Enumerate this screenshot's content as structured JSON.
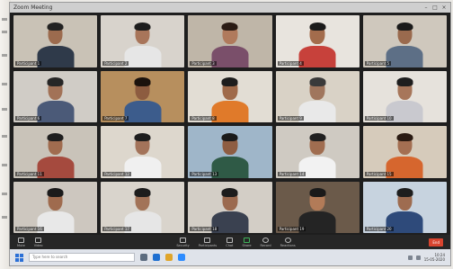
{
  "window": {
    "title": "Zoom Meeting"
  },
  "participants": [
    {
      "name": "Participant 1",
      "bg": "#c9c2b6",
      "skin": "#9c6b4e",
      "shirt": "#2f3a4a",
      "hair": "#222"
    },
    {
      "name": "Participant 2",
      "bg": "#d8d3cc",
      "skin": "#a8755a",
      "shirt": "#e6e6e6",
      "hair": "#1d1d1d"
    },
    {
      "name": "Participant 3",
      "bg": "#bfb6a8",
      "skin": "#b07a5c",
      "shirt": "#7a4f6a",
      "hair": "#2a1b14"
    },
    {
      "name": "Participant 4",
      "bg": "#e8e4de",
      "skin": "#a36c4c",
      "shirt": "#c7413b",
      "hair": "#1b1b1b"
    },
    {
      "name": "Participant 5",
      "bg": "#cfc8bd",
      "skin": "#9a6a4e",
      "shirt": "#5d6f86",
      "hair": "#1a1a1a"
    },
    {
      "name": "Participant 6",
      "bg": "#d0ccc6",
      "skin": "#a27257",
      "shirt": "#4b5a78",
      "hair": "#262626"
    },
    {
      "name": "Participant 7",
      "bg": "#b78f5e",
      "skin": "#8d5c40",
      "shirt": "#3c5c8c",
      "hair": "#1b120d"
    },
    {
      "name": "Participant 8",
      "bg": "#e2ddd4",
      "skin": "#9f6a4a",
      "shirt": "#e07a2a",
      "hair": "#1d1d1d"
    },
    {
      "name": "Participant 9",
      "bg": "#d9d2c6",
      "skin": "#a0765d",
      "shirt": "#e9e9e9",
      "hair": "#3a3a3a"
    },
    {
      "name": "Participant 10",
      "bg": "#e6e2dc",
      "skin": "#a7765a",
      "shirt": "#c9c9cf",
      "hair": "#1e1e1e"
    },
    {
      "name": "Participant 11",
      "bg": "#c9c3b9",
      "skin": "#a06c4f",
      "shirt": "#a54a3e",
      "hair": "#1e1e1e"
    },
    {
      "name": "Participant 12",
      "bg": "#ddd7cd",
      "skin": "#a3735a",
      "shirt": "#f0f0f0",
      "hair": "#1e1e1e"
    },
    {
      "name": "Participant 13",
      "bg": "#9fb6c9",
      "skin": "#8e5d42",
      "shirt": "#2f5a46",
      "hair": "#1a1a1a"
    },
    {
      "name": "Participant 14",
      "bg": "#cfcac2",
      "skin": "#a06d50",
      "shirt": "#f2f2f2",
      "hair": "#202020"
    },
    {
      "name": "Participant 15",
      "bg": "#d6cbbb",
      "skin": "#a46f52",
      "shirt": "#d6662e",
      "hair": "#2a1a12"
    },
    {
      "name": "Participant 16",
      "bg": "#cdc7bf",
      "skin": "#9f6b4e",
      "shirt": "#e8e8e8",
      "hair": "#1b1b1b"
    },
    {
      "name": "Participant 17",
      "bg": "#d9d4cc",
      "skin": "#a27358",
      "shirt": "#e6e6e6",
      "hair": "#1d1d1d"
    },
    {
      "name": "Participant 18",
      "bg": "#d3cec6",
      "skin": "#9b6a4f",
      "shirt": "#3a4150",
      "hair": "#1c1c1c"
    },
    {
      "name": "Participant 19",
      "bg": "#6b5a4a",
      "skin": "#b27b58",
      "shirt": "#242424",
      "hair": "#1a1a1a"
    },
    {
      "name": "Participant 20",
      "bg": "#c7d3df",
      "skin": "#9e6c50",
      "shirt": "#2e4a7a",
      "hair": "#1e1e1e"
    }
  ],
  "toolbar": {
    "buttons": [
      {
        "label": "Mute"
      },
      {
        "label": "Video"
      },
      {
        "label": "Security"
      },
      {
        "label": "Participants"
      },
      {
        "label": "Chat"
      },
      {
        "label": "Share"
      },
      {
        "label": "Record"
      },
      {
        "label": "Reactions"
      }
    ],
    "end_label": "End"
  },
  "taskbar": {
    "search_placeholder": "Type here to search",
    "clock_time": "10:24",
    "clock_date": "15-05-2020"
  },
  "colors": {
    "accent_end": "#d8442f",
    "taskbar_bg": "#dfe3ea"
  }
}
